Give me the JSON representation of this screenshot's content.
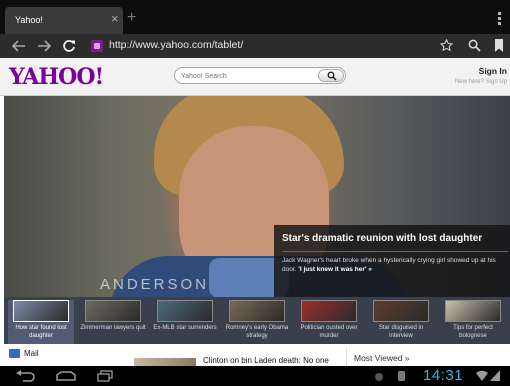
{
  "browser": {
    "tab": {
      "title": "Yahoo!",
      "close_glyph": "×"
    },
    "new_tab_glyph": "+",
    "url": "http://www.yahoo.com/tablet/",
    "icons": [
      "back-icon",
      "forward-icon",
      "reload-icon",
      "favicon",
      "star-icon",
      "search-icon",
      "bookmarks-icon",
      "overflow-menu-icon"
    ]
  },
  "header": {
    "logo": "YAHOO!",
    "search_placeholder": "Yahoo! Search",
    "sign_in": "Sign In",
    "new_here": "New here? Sign Up"
  },
  "hero": {
    "watermark": "ANDERSON",
    "title": "Star's dramatic reunion with lost daughter",
    "desc": "Jack Wagner's heart broke when a hysterically crying girl showed up at his door.",
    "desc_link": "'I just knew it was her' »"
  },
  "carousel": [
    {
      "label": "How star found lost daughter",
      "active": true,
      "color": "#7d8aa8"
    },
    {
      "label": "Zimmerman lawyers quit",
      "active": false,
      "color": "#6d6a5e"
    },
    {
      "label": "Ex-MLB star surrenders",
      "active": false,
      "color": "#4c6b7c"
    },
    {
      "label": "Romney's early Obama strategy",
      "active": false,
      "color": "#7a6a56"
    },
    {
      "label": "Politician ousted over murder",
      "active": false,
      "color": "#9b2f2f"
    },
    {
      "label": "Star disguised in interview",
      "active": false,
      "color": "#5e3e2c"
    },
    {
      "label": "Tips for perfect bolognese",
      "active": false,
      "color": "#c9c0ae"
    }
  ],
  "below": {
    "mail": "Mail",
    "headline": "Clinton on bin Laden death: No one",
    "most_viewed": "Most Viewed »"
  },
  "system": {
    "clock": "14:31"
  },
  "colors": {
    "yahoo_purple": "#7b0099",
    "clock_blue": "#33b5e5",
    "tab_bg": "#3a3a3a"
  }
}
